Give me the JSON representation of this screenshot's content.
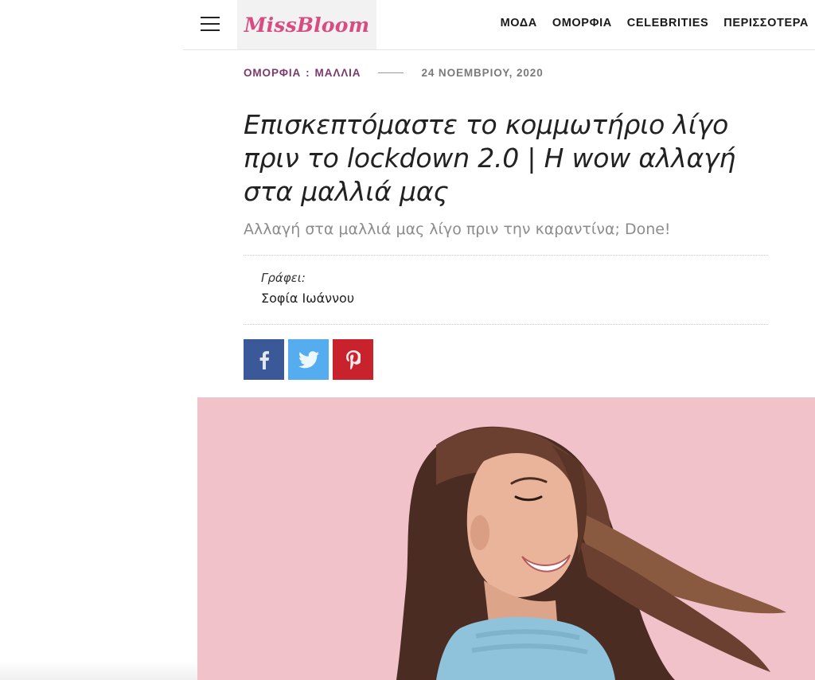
{
  "header": {
    "logo_text": "MissBloom",
    "nav": [
      "ΜΟΔΑ",
      "ΟΜΟΡΦΙΑ",
      "CELEBRITIES",
      "ΠΕΡΙΣΣΟΤΕΡΑ"
    ]
  },
  "article": {
    "category_main": "ΟΜΟΡΦΙΑ",
    "category_separator": ":",
    "category_sub": "ΜΑΛΛΙΑ",
    "date": "24 ΝΟΕΜΒΡΙΟΥ, 2020",
    "title": "Επισκεπτόμαστε το κομμωτήριο λίγο πριν το lockdown 2.0 | Η wow αλλαγή στα μαλλιά μας",
    "subtitle": "Αλλαγή στα μαλλιά μας λίγο πριν την καραντίνα; Done!",
    "author_label": "Γράφει:",
    "author_name": "Σοφία Ιωάννου"
  },
  "share": {
    "facebook_icon": "facebook-icon",
    "twitter_icon": "twitter-icon",
    "pinterest_icon": "pinterest-icon"
  },
  "colors": {
    "brand_pink": "#d84c82",
    "category_purple": "#7a3a6e",
    "facebook": "#3b5998",
    "twitter": "#55acee",
    "pinterest": "#c8232c",
    "hero_background": "#f2c2cb"
  }
}
